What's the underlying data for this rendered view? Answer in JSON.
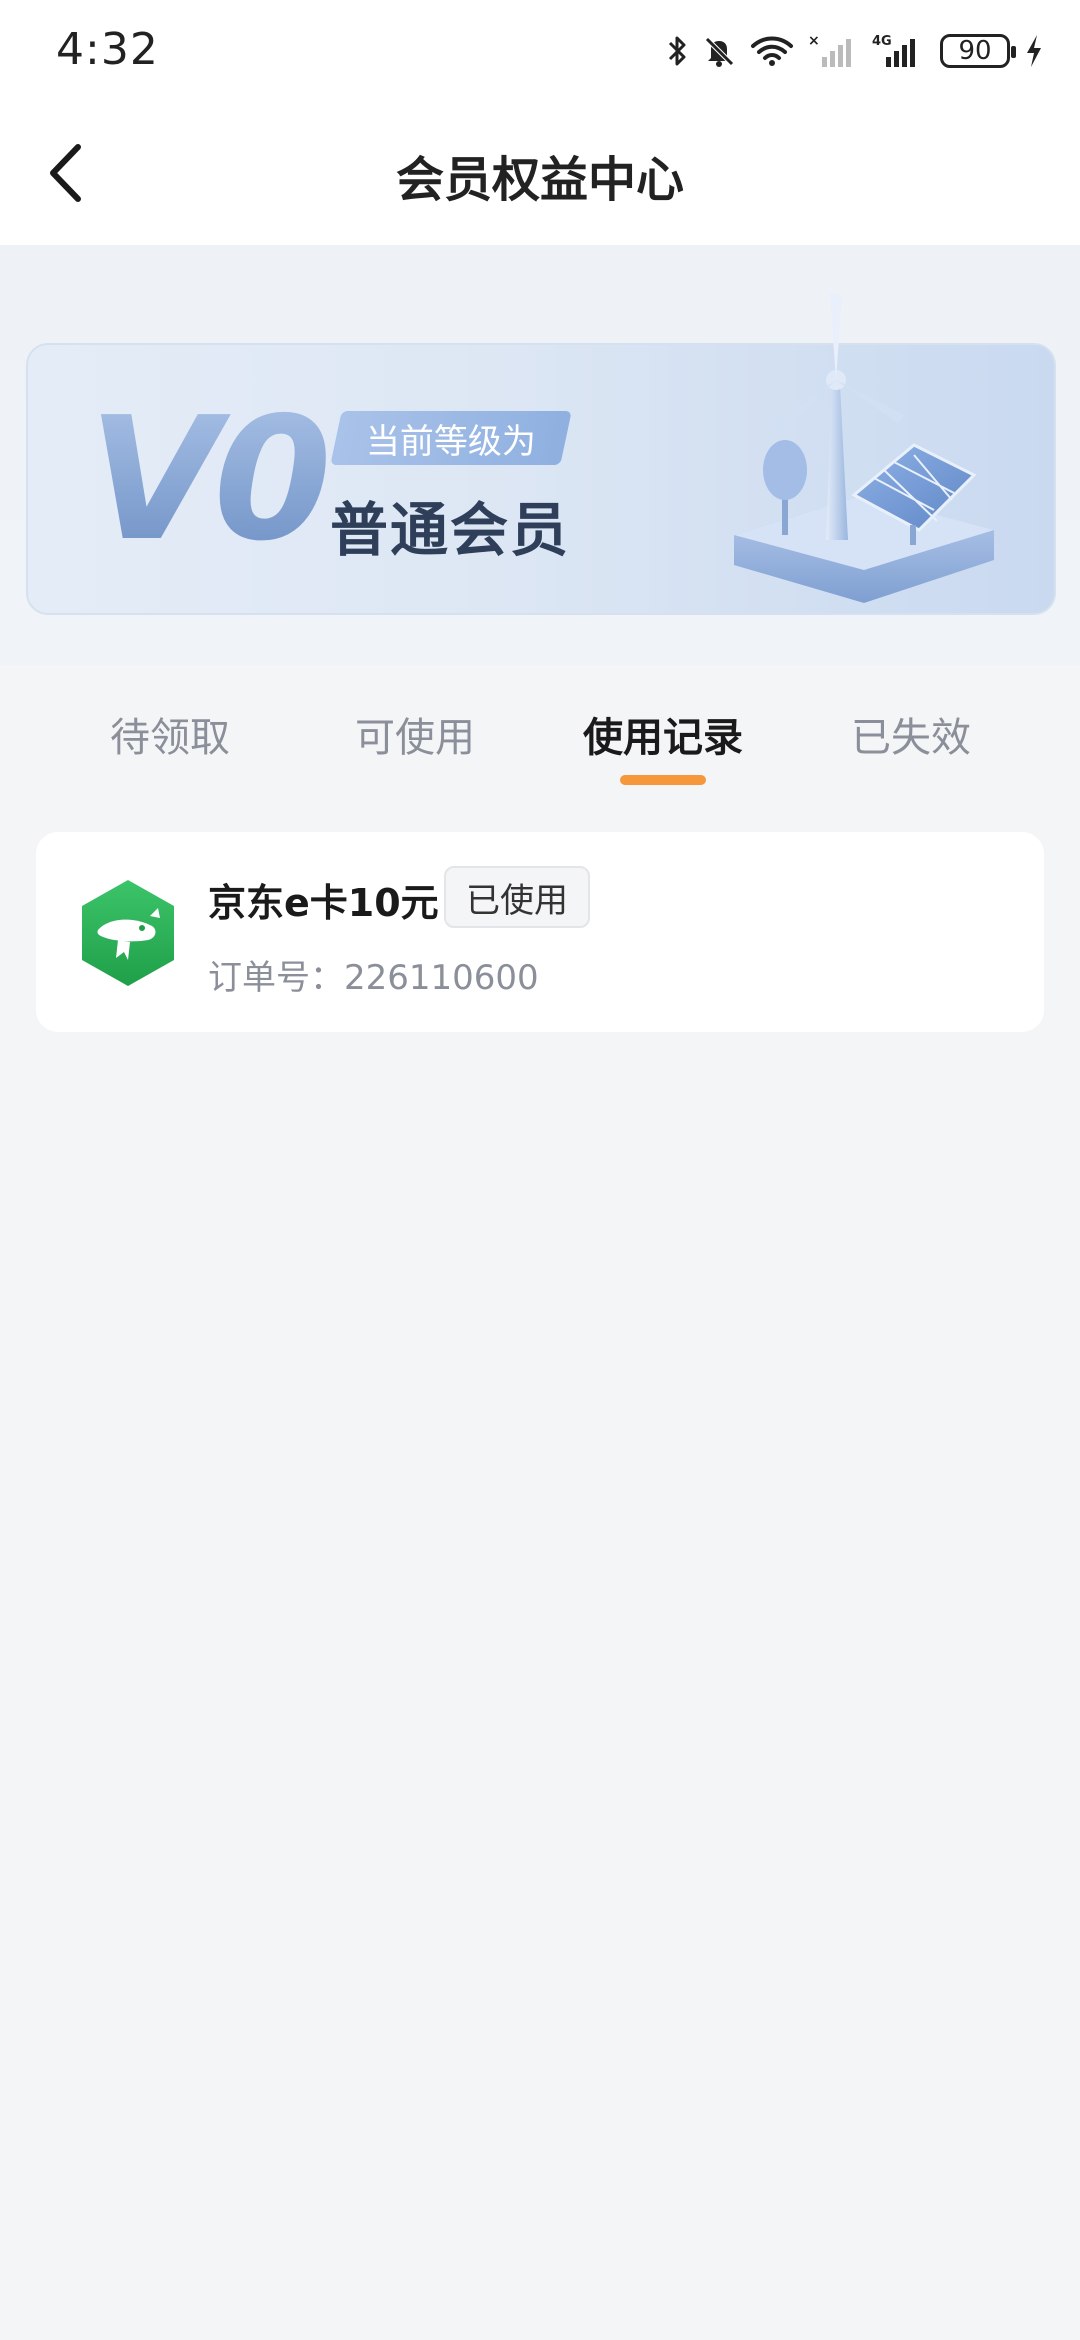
{
  "status_bar": {
    "time": "4:32",
    "battery": "90",
    "icons": [
      "bluetooth-icon",
      "mute-icon",
      "wifi-icon",
      "signal-off-icon",
      "signal-4g-icon",
      "battery-icon",
      "charging-icon"
    ]
  },
  "header": {
    "title": "会员权益中心",
    "back_icon": "chevron-left-icon"
  },
  "banner": {
    "level_code": "V0",
    "level_tag": "当前等级为",
    "level_name": "普通会员"
  },
  "tabs": [
    {
      "label": "待领取",
      "active": false
    },
    {
      "label": "可使用",
      "active": false
    },
    {
      "label": "使用记录",
      "active": true
    },
    {
      "label": "已失效",
      "active": false
    }
  ],
  "colors": {
    "accent_indicator": "#f5973a",
    "logo_green": "#2fb456",
    "page_background": "#f4f5f7"
  },
  "records": [
    {
      "title": "京东e卡10元",
      "status": "已使用",
      "order_label": "订单号：",
      "order_number": "226110600",
      "logo_icon": "jd-logo-icon"
    }
  ]
}
